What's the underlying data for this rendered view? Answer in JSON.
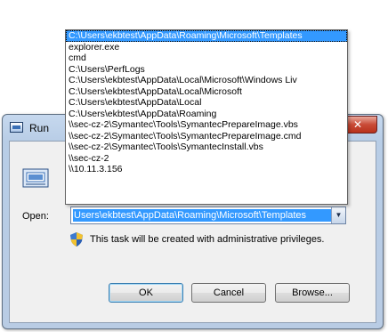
{
  "window": {
    "title": "Run",
    "close_glyph": "✕"
  },
  "open_label": "Open:",
  "combo": {
    "value": "Users\\ekbtest\\AppData\\Roaming\\Microsoft\\Templates",
    "arrow_glyph": "▼"
  },
  "admin_note": "This task will be created with administrative privileges.",
  "buttons": {
    "ok": "OK",
    "cancel": "Cancel",
    "browse": "Browse..."
  },
  "dropdown": {
    "items": [
      "C:\\Users\\ekbtest\\AppData\\Roaming\\Microsoft\\Templates",
      "explorer.exe",
      "cmd",
      "C:\\Users\\PerfLogs",
      "C:\\Users\\ekbtest\\AppData\\Local\\Microsoft\\Windows Liv",
      "C:\\Users\\ekbtest\\AppData\\Local\\Microsoft",
      "C:\\Users\\ekbtest\\AppData\\Local",
      "C:\\Users\\ekbtest\\AppData\\Roaming",
      "\\\\sec-cz-2\\Symantec\\Tools\\SymantecPrepareImage.vbs",
      "\\\\sec-cz-2\\Symantec\\Tools\\SymantecPrepareImage.cmd",
      "\\\\sec-cz-2\\Symantec\\Tools\\SymantecInstall.vbs",
      "\\\\sec-cz-2",
      "\\\\10.11.3.156"
    ],
    "selected_index": 0
  },
  "icons": {
    "title": "run-icon",
    "dialog": "run-icon",
    "shield": "uac-shield-icon"
  }
}
